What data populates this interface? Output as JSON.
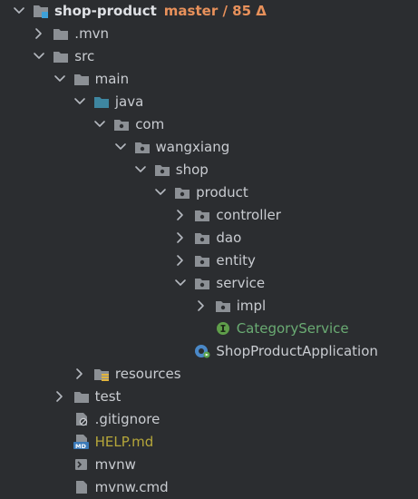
{
  "colors": {
    "background": "#2b2d30",
    "text": "#c9ccd1",
    "branch": "#e8915b",
    "interface": "#6aab73",
    "markdown": "#b5a63a",
    "folder": "#8c9095",
    "source_folder": "#3e86a0"
  },
  "tree": [
    {
      "label": "shop-product",
      "extra": "master / 85 Δ",
      "indent": 0,
      "chevron": "down",
      "icon": "module-folder-icon",
      "style": "bold"
    },
    {
      "label": ".mvn",
      "indent": 1,
      "chevron": "right",
      "icon": "folder-icon"
    },
    {
      "label": "src",
      "indent": 1,
      "chevron": "down",
      "icon": "folder-icon"
    },
    {
      "label": "main",
      "indent": 2,
      "chevron": "down",
      "icon": "folder-icon"
    },
    {
      "label": "java",
      "indent": 3,
      "chevron": "down",
      "icon": "source-folder-icon"
    },
    {
      "label": "com",
      "indent": 4,
      "chevron": "down",
      "icon": "package-icon"
    },
    {
      "label": "wangxiang",
      "indent": 5,
      "chevron": "down",
      "icon": "package-icon"
    },
    {
      "label": "shop",
      "indent": 6,
      "chevron": "down",
      "icon": "package-icon"
    },
    {
      "label": "product",
      "indent": 7,
      "chevron": "down",
      "icon": "package-icon"
    },
    {
      "label": "controller",
      "indent": 8,
      "chevron": "right",
      "icon": "package-icon"
    },
    {
      "label": "dao",
      "indent": 8,
      "chevron": "right",
      "icon": "package-icon"
    },
    {
      "label": "entity",
      "indent": 8,
      "chevron": "right",
      "icon": "package-icon"
    },
    {
      "label": "service",
      "indent": 8,
      "chevron": "down",
      "icon": "package-icon"
    },
    {
      "label": "impl",
      "indent": 9,
      "chevron": "right",
      "icon": "package-icon"
    },
    {
      "label": "CategoryService",
      "indent": 9,
      "chevron": "none",
      "icon": "interface-icon",
      "style": "interface"
    },
    {
      "label": "ShopProductApplication",
      "indent": 8,
      "chevron": "none",
      "icon": "spring-boot-app-icon"
    },
    {
      "label": "resources",
      "indent": 3,
      "chevron": "right",
      "icon": "resources-folder-icon"
    },
    {
      "label": "test",
      "indent": 2,
      "chevron": "right",
      "icon": "folder-icon"
    },
    {
      "label": ".gitignore",
      "indent": 2,
      "chevron": "none",
      "icon": "gitignore-file-icon"
    },
    {
      "label": "HELP.md",
      "indent": 2,
      "chevron": "none",
      "icon": "markdown-file-icon",
      "style": "md"
    },
    {
      "label": "mvnw",
      "indent": 2,
      "chevron": "none",
      "icon": "shell-script-icon"
    },
    {
      "label": "mvnw.cmd",
      "indent": 2,
      "chevron": "none",
      "icon": "cmd-file-icon"
    }
  ]
}
